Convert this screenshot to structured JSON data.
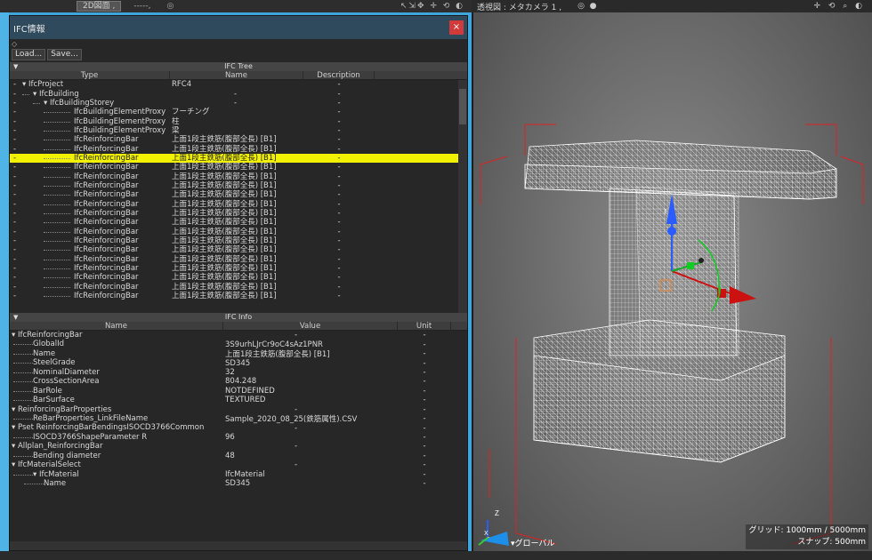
{
  "left_topbar": {
    "tab": "2D図面 ,",
    "dash": "-----,",
    "circle": "◎",
    "icons": "↖⇲✥ ✛ ⟲ ◐"
  },
  "panel": {
    "title": "IFC情報",
    "close": "×",
    "load": "Load...",
    "save": "Save...",
    "tree_header": "IFC Tree",
    "tree_columns": [
      "Type",
      "Name",
      "Description"
    ],
    "info_header": "IFC Info",
    "info_columns": [
      "Name",
      "Value",
      "Unit"
    ]
  },
  "tree_rows": [
    {
      "type": "IfcProject",
      "name": "RFC4",
      "desc": "-",
      "depth": 0,
      "expander": true
    },
    {
      "type": "IfcBuilding",
      "name": "-",
      "desc": "-",
      "depth": 1,
      "expander": true
    },
    {
      "type": "IfcBuildingStorey",
      "name": "-",
      "desc": "-",
      "depth": 2,
      "expander": true
    },
    {
      "type": "IfcBuildingElementProxy",
      "name": "フーチング",
      "desc": "-",
      "depth": 3
    },
    {
      "type": "IfcBuildingElementProxy",
      "name": "柱",
      "desc": "-",
      "depth": 3
    },
    {
      "type": "IfcBuildingElementProxy",
      "name": "梁",
      "desc": "-",
      "depth": 3
    },
    {
      "type": "IfcReinforcingBar",
      "name": "上面1段主鉄筋(腹部全長)  [B1]",
      "desc": "-",
      "depth": 3
    },
    {
      "type": "IfcReinforcingBar",
      "name": "上面1段主鉄筋(腹部全長)  [B1]",
      "desc": "-",
      "depth": 3
    },
    {
      "type": "IfcReinforcingBar",
      "name": "上面1段主鉄筋(腹部全長)  [B1]",
      "desc": "-",
      "depth": 3,
      "selected": true
    },
    {
      "type": "IfcReinforcingBar",
      "name": "上面1段主鉄筋(腹部全長)  [B1]",
      "desc": "-",
      "depth": 3
    },
    {
      "type": "IfcReinforcingBar",
      "name": "上面1段主鉄筋(腹部全長)  [B1]",
      "desc": "-",
      "depth": 3
    },
    {
      "type": "IfcReinforcingBar",
      "name": "上面1段主鉄筋(腹部全長)  [B1]",
      "desc": "-",
      "depth": 3
    },
    {
      "type": "IfcReinforcingBar",
      "name": "上面1段主鉄筋(腹部全長)  [B1]",
      "desc": "-",
      "depth": 3
    },
    {
      "type": "IfcReinforcingBar",
      "name": "上面1段主鉄筋(腹部全長)  [B1]",
      "desc": "-",
      "depth": 3
    },
    {
      "type": "IfcReinforcingBar",
      "name": "上面1段主鉄筋(腹部全長)  [B1]",
      "desc": "-",
      "depth": 3
    },
    {
      "type": "IfcReinforcingBar",
      "name": "上面1段主鉄筋(腹部全長)  [B1]",
      "desc": "-",
      "depth": 3
    },
    {
      "type": "IfcReinforcingBar",
      "name": "上面1段主鉄筋(腹部全長)  [B1]",
      "desc": "-",
      "depth": 3
    },
    {
      "type": "IfcReinforcingBar",
      "name": "上面1段主鉄筋(腹部全長)  [B1]",
      "desc": "-",
      "depth": 3
    },
    {
      "type": "IfcReinforcingBar",
      "name": "上面1段主鉄筋(腹部全長)  [B1]",
      "desc": "-",
      "depth": 3
    },
    {
      "type": "IfcReinforcingBar",
      "name": "上面1段主鉄筋(腹部全長)  [B1]",
      "desc": "-",
      "depth": 3
    },
    {
      "type": "IfcReinforcingBar",
      "name": "上面1段主鉄筋(腹部全長)  [B1]",
      "desc": "-",
      "depth": 3
    },
    {
      "type": "IfcReinforcingBar",
      "name": "上面1段主鉄筋(腹部全長)  [B1]",
      "desc": "-",
      "depth": 3
    },
    {
      "type": "IfcReinforcingBar",
      "name": "上面1段主鉄筋(腹部全長)  [B1]",
      "desc": "-",
      "depth": 3
    },
    {
      "type": "IfcReinforcingBar",
      "name": "上面1段主鉄筋(腹部全長)  [B1]",
      "desc": "-",
      "depth": 3
    }
  ],
  "info_rows": [
    {
      "name": "IfcReinforcingBar",
      "value": "-",
      "unit": "-",
      "depth": 0,
      "expander": true
    },
    {
      "name": "GlobalId",
      "value": "3S9urhLJrCr9oC4sAz1PNR",
      "unit": "-",
      "depth": 1
    },
    {
      "name": "Name",
      "value": "上面1段主鉄筋(腹部全長)  [B1]",
      "unit": "-",
      "depth": 1
    },
    {
      "name": "SteelGrade",
      "value": "SD345",
      "unit": "-",
      "depth": 1
    },
    {
      "name": "NominalDiameter",
      "value": "32",
      "unit": "-",
      "depth": 1
    },
    {
      "name": "CrossSectionArea",
      "value": "804.248",
      "unit": "-",
      "depth": 1
    },
    {
      "name": "BarRole",
      "value": "NOTDEFINED",
      "unit": "-",
      "depth": 1
    },
    {
      "name": "BarSurface",
      "value": "TEXTURED",
      "unit": "-",
      "depth": 1
    },
    {
      "name": "ReinforcingBarProperties",
      "value": "-",
      "unit": "-",
      "depth": 0,
      "expander": true
    },
    {
      "name": "ReBarProperties_LinkFileName",
      "value": "Sample_2020_08_25(鉄筋属性).CSV",
      "unit": "-",
      "depth": 1
    },
    {
      "name": "Pset ReinforcingBarBendingsISOCD3766Common",
      "value": "-",
      "unit": "-",
      "depth": 0,
      "expander": true
    },
    {
      "name": "ISOCD3766ShapeParameter R",
      "value": "96",
      "unit": "-",
      "depth": 1
    },
    {
      "name": "Allplan_ReinforcingBar",
      "value": "-",
      "unit": "-",
      "depth": 0,
      "expander": true
    },
    {
      "name": "Bending diameter",
      "value": "48",
      "unit": "-",
      "depth": 1
    },
    {
      "name": "IfcMaterialSelect",
      "value": "-",
      "unit": "-",
      "depth": 0,
      "expander": true
    },
    {
      "name": "IfcMaterial",
      "value": "IfcMaterial",
      "unit": "-",
      "depth": 1,
      "expander": true
    },
    {
      "name": "Name",
      "value": "SD345",
      "unit": "-",
      "depth": 2
    }
  ],
  "viewport": {
    "title": "透視図 : メタカメラ 1 ,",
    "icons": "✛ ⟲ ⌕ ◐",
    "grid_text": "グリッド: 1000mm / 5000mm",
    "snap_text": "スナップ: 500mm",
    "axis_label": "▾グローバル",
    "z_label": "Z",
    "x_label": "X"
  }
}
